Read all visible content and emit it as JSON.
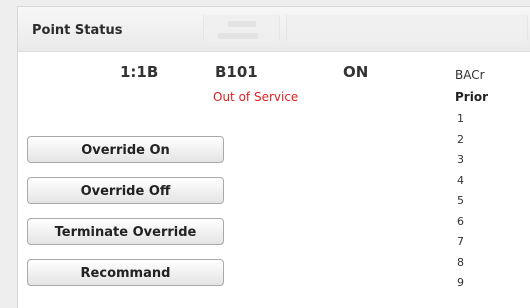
{
  "panel": {
    "title": "Point Status"
  },
  "status": {
    "address": "1:1B",
    "name": "B101",
    "value": "ON",
    "state": "Out of Service"
  },
  "buttons": {
    "override_on": "Override On",
    "override_off": "Override Off",
    "terminate_override": "Terminate Override",
    "recommand": "Recommand"
  },
  "priority": {
    "bac_label": "BACr",
    "header": "Prior",
    "levels": [
      "1",
      "2",
      "3",
      "4",
      "5",
      "6",
      "7",
      "8",
      "9"
    ]
  },
  "colors": {
    "alert": "#e02020"
  }
}
